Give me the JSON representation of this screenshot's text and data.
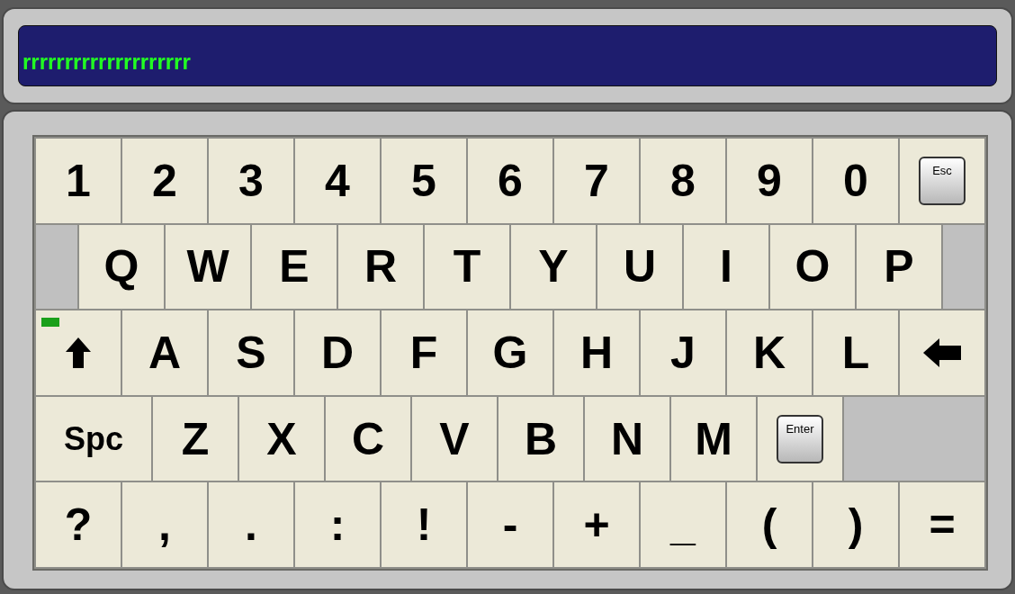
{
  "display": {
    "value": "rrrrrrrrrrrrrrrrrrrr"
  },
  "keyboard": {
    "rows": [
      {
        "keys": [
          {
            "kind": "char",
            "label": "1"
          },
          {
            "kind": "char",
            "label": "2"
          },
          {
            "kind": "char",
            "label": "3"
          },
          {
            "kind": "char",
            "label": "4"
          },
          {
            "kind": "char",
            "label": "5"
          },
          {
            "kind": "char",
            "label": "6"
          },
          {
            "kind": "char",
            "label": "7"
          },
          {
            "kind": "char",
            "label": "8"
          },
          {
            "kind": "char",
            "label": "9"
          },
          {
            "kind": "char",
            "label": "0"
          },
          {
            "kind": "esc",
            "label": "Esc"
          }
        ]
      },
      {
        "keys": [
          {
            "kind": "blank"
          },
          {
            "kind": "char",
            "label": "Q"
          },
          {
            "kind": "char",
            "label": "W"
          },
          {
            "kind": "char",
            "label": "E"
          },
          {
            "kind": "char",
            "label": "R"
          },
          {
            "kind": "char",
            "label": "T"
          },
          {
            "kind": "char",
            "label": "Y"
          },
          {
            "kind": "char",
            "label": "U"
          },
          {
            "kind": "char",
            "label": "I"
          },
          {
            "kind": "char",
            "label": "O"
          },
          {
            "kind": "char",
            "label": "P"
          },
          {
            "kind": "blank"
          }
        ]
      },
      {
        "keys": [
          {
            "kind": "shift",
            "on": true
          },
          {
            "kind": "char",
            "label": "A"
          },
          {
            "kind": "char",
            "label": "S"
          },
          {
            "kind": "char",
            "label": "D"
          },
          {
            "kind": "char",
            "label": "F"
          },
          {
            "kind": "char",
            "label": "G"
          },
          {
            "kind": "char",
            "label": "H"
          },
          {
            "kind": "char",
            "label": "J"
          },
          {
            "kind": "char",
            "label": "K"
          },
          {
            "kind": "char",
            "label": "L"
          },
          {
            "kind": "backspace"
          }
        ]
      },
      {
        "keys": [
          {
            "kind": "space",
            "label": "Spc"
          },
          {
            "kind": "char",
            "label": "Z"
          },
          {
            "kind": "char",
            "label": "X"
          },
          {
            "kind": "char",
            "label": "C"
          },
          {
            "kind": "char",
            "label": "V"
          },
          {
            "kind": "char",
            "label": "B"
          },
          {
            "kind": "char",
            "label": "N"
          },
          {
            "kind": "char",
            "label": "M"
          },
          {
            "kind": "enter",
            "label": "Enter"
          },
          {
            "kind": "blank"
          }
        ]
      },
      {
        "keys": [
          {
            "kind": "char",
            "label": "?"
          },
          {
            "kind": "char",
            "label": ","
          },
          {
            "kind": "char",
            "label": "."
          },
          {
            "kind": "char",
            "label": ":"
          },
          {
            "kind": "char",
            "label": "!"
          },
          {
            "kind": "char",
            "label": "-"
          },
          {
            "kind": "char",
            "label": "+"
          },
          {
            "kind": "char",
            "label": "_"
          },
          {
            "kind": "char",
            "label": "("
          },
          {
            "kind": "char",
            "label": ")"
          },
          {
            "kind": "char",
            "label": "="
          }
        ]
      }
    ]
  }
}
